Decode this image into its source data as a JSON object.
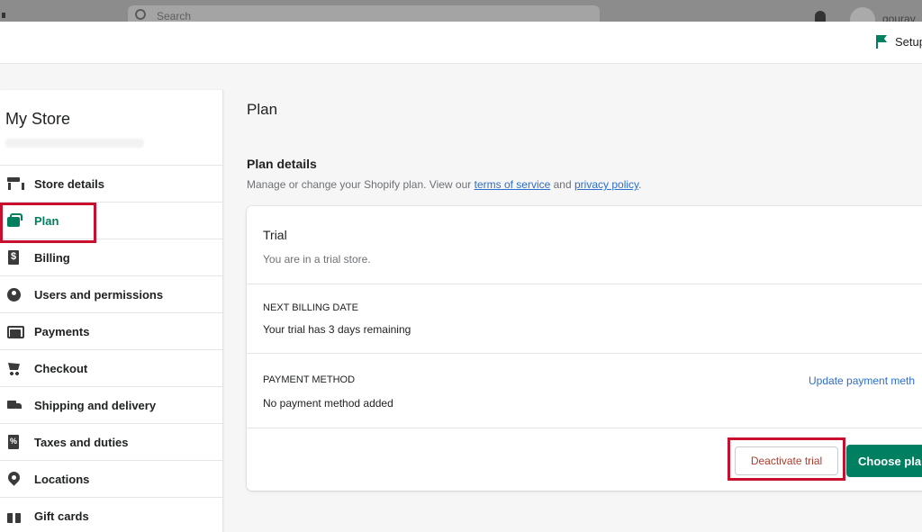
{
  "topbar": {
    "search_placeholder": "Search",
    "user_name": "gourav"
  },
  "header": {
    "setup_label": "Setup"
  },
  "sidebar": {
    "store_name": "My Store",
    "items": [
      {
        "label": "Store details",
        "icon": "store-icon"
      },
      {
        "label": "Plan",
        "icon": "plan-icon",
        "active": true
      },
      {
        "label": "Billing",
        "icon": "billing-icon"
      },
      {
        "label": "Users and permissions",
        "icon": "users-icon"
      },
      {
        "label": "Payments",
        "icon": "payments-icon"
      },
      {
        "label": "Checkout",
        "icon": "cart-icon"
      },
      {
        "label": "Shipping and delivery",
        "icon": "truck-icon"
      },
      {
        "label": "Taxes and duties",
        "icon": "tax-icon"
      },
      {
        "label": "Locations",
        "icon": "pin-icon"
      },
      {
        "label": "Gift cards",
        "icon": "gift-icon"
      }
    ]
  },
  "main": {
    "page_title": "Plan",
    "section_title": "Plan details",
    "section_desc_prefix": "Manage or change your Shopify plan. View our ",
    "terms_link": "terms of service",
    "desc_and": " and ",
    "privacy_link": "privacy policy",
    "desc_suffix": ".",
    "card": {
      "trial_title": "Trial",
      "trial_desc": "You are in a trial store.",
      "billing_label": "NEXT BILLING DATE",
      "billing_value": "Your trial has 3 days remaining",
      "payment_label": "PAYMENT METHOD",
      "payment_value": "No payment method added",
      "update_link": "Update payment meth",
      "deactivate_button": "Deactivate trial",
      "choose_button": "Choose plan"
    }
  },
  "colors": {
    "accent_green": "#008060",
    "link_blue": "#2c6ecb",
    "highlight_red": "#c8102e"
  }
}
